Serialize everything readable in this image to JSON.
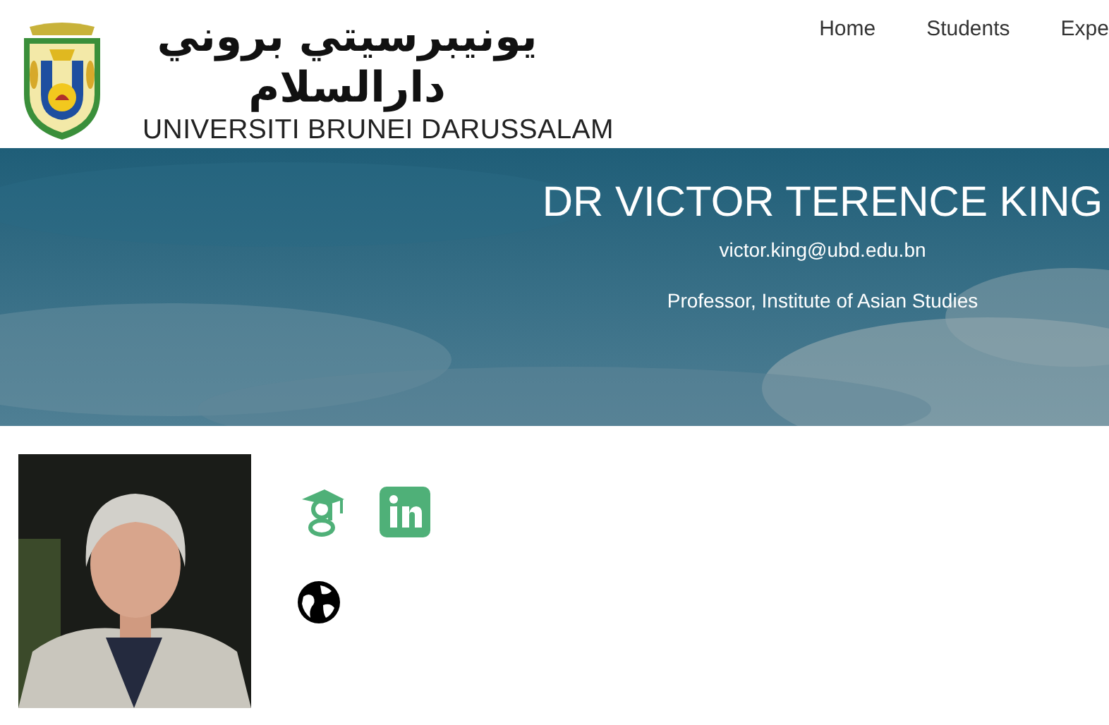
{
  "header": {
    "logo_script": "يونيبرسيتي بروني دارالسلام",
    "logo_name": "UNIVERSITI BRUNEI DARUSSALAM"
  },
  "nav": [
    {
      "label": "Home"
    },
    {
      "label": "Students"
    },
    {
      "label": "Expe"
    }
  ],
  "profile": {
    "name": "DR VICTOR TERENCE KING",
    "email": "victor.king@ubd.edu.bn",
    "position": "Professor, Institute of Asian Studies"
  },
  "links": [
    {
      "kind": "scholar"
    },
    {
      "kind": "linkedin"
    },
    {
      "kind": "website"
    }
  ]
}
